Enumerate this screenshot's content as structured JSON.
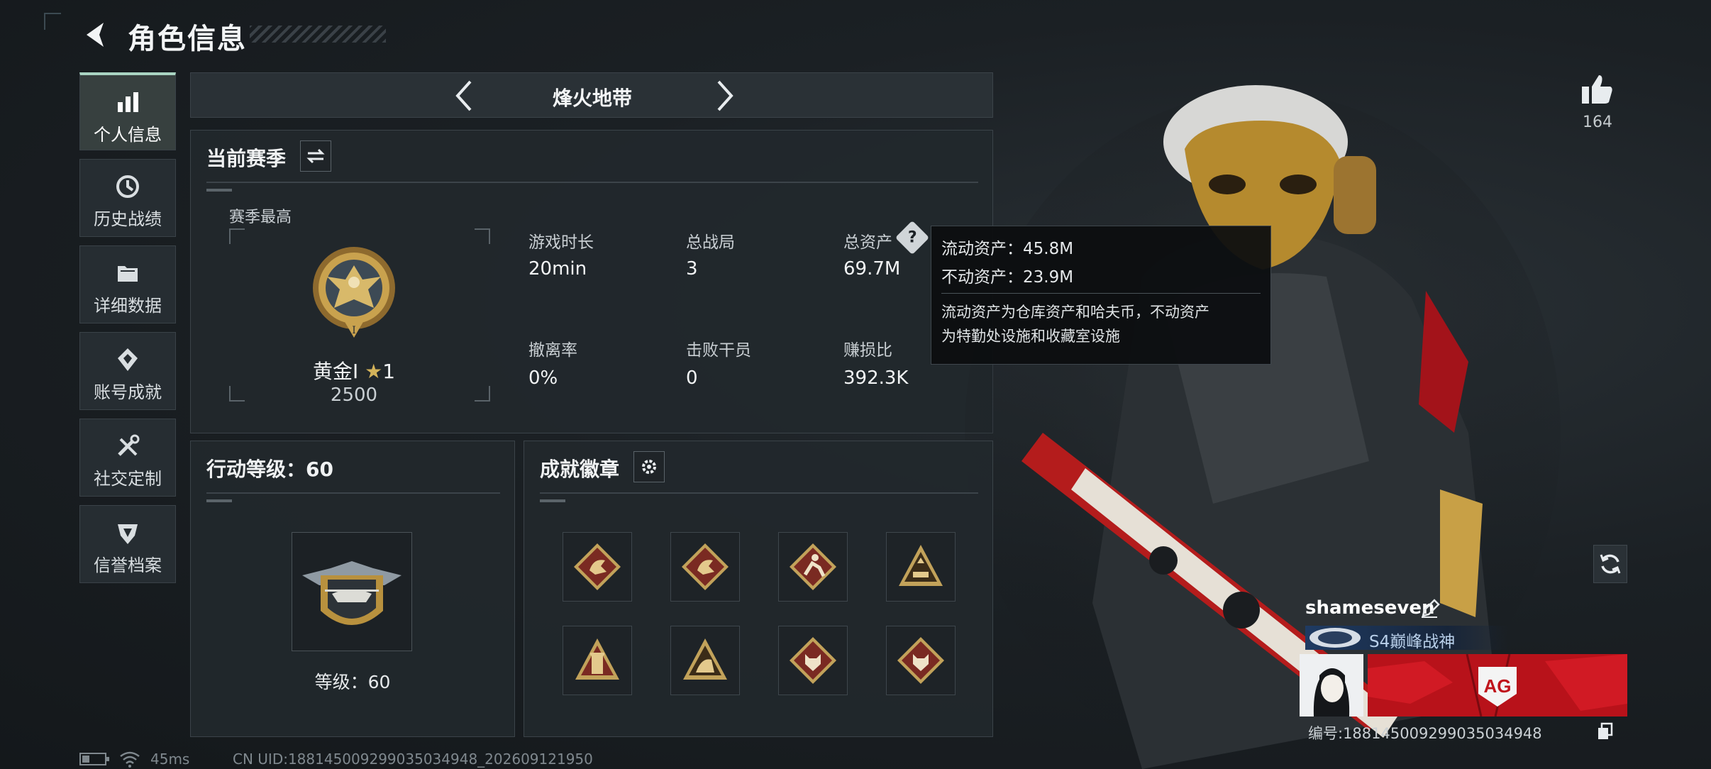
{
  "header": {
    "title": "角色信息"
  },
  "sidebar": {
    "items": [
      {
        "label": "个人信息",
        "icon": "bar-chart-icon",
        "active": true
      },
      {
        "label": "历史战绩",
        "icon": "history-clock-icon"
      },
      {
        "label": "详细数据",
        "icon": "folder-icon"
      },
      {
        "label": "账号成就",
        "icon": "achievement-icon"
      },
      {
        "label": "社交定制",
        "icon": "tools-icon"
      },
      {
        "label": "信誉档案",
        "icon": "reputation-icon"
      }
    ]
  },
  "mode_nav": {
    "current": "烽火地带"
  },
  "season": {
    "title": "当前赛季",
    "best_label": "赛季最高",
    "rank_name": "黄金Ⅰ",
    "rank_stars": "1",
    "rank_score": "2500",
    "rank_emblem_numeral": "I",
    "stats": [
      {
        "label": "游戏时长",
        "value": "20min"
      },
      {
        "label": "总战局",
        "value": "3"
      },
      {
        "label": "总资产",
        "value": "69.7M",
        "has_help": true
      },
      {
        "label": "撤离率",
        "value": "0%"
      },
      {
        "label": "击败干员",
        "value": "0"
      },
      {
        "label": "赚损比",
        "value": "392.3K"
      }
    ]
  },
  "tooltip": {
    "liquid": "流动资产：45.8M",
    "fixed": "不动资产：23.9M",
    "desc_line1": "流动资产为仓库资产和哈夫币，不动资产",
    "desc_line2": "为特勤处设施和收藏室设施"
  },
  "action_level": {
    "title": "行动等级：60",
    "level_label": "等级：60"
  },
  "badges": {
    "title": "成就徽章",
    "items": [
      {
        "icon": "dragon-diamond-badge-icon"
      },
      {
        "icon": "dragon-diamond-badge-icon"
      },
      {
        "icon": "runner-diamond-badge-icon"
      },
      {
        "icon": "triangle-gold-badge-icon"
      },
      {
        "icon": "triangle-tower-badge-icon"
      },
      {
        "icon": "triangle-beast-badge-icon"
      },
      {
        "icon": "wolf-diamond-badge-icon"
      },
      {
        "icon": "wolf-diamond-badge-icon"
      }
    ]
  },
  "social": {
    "like_count": "164"
  },
  "profile_card": {
    "username": "shameseven",
    "title_badge": "S4巅峰战神",
    "banner_logo": "AG",
    "uid": "编号:1881450092990350349​48"
  },
  "status_bar": {
    "ping": "45ms",
    "uid_line": "CN UID:1881450092990350349​48_202609121950"
  },
  "colors": {
    "accent": "#a9d4c2",
    "gold": "#c9a24e",
    "banner": "#c0131b"
  }
}
